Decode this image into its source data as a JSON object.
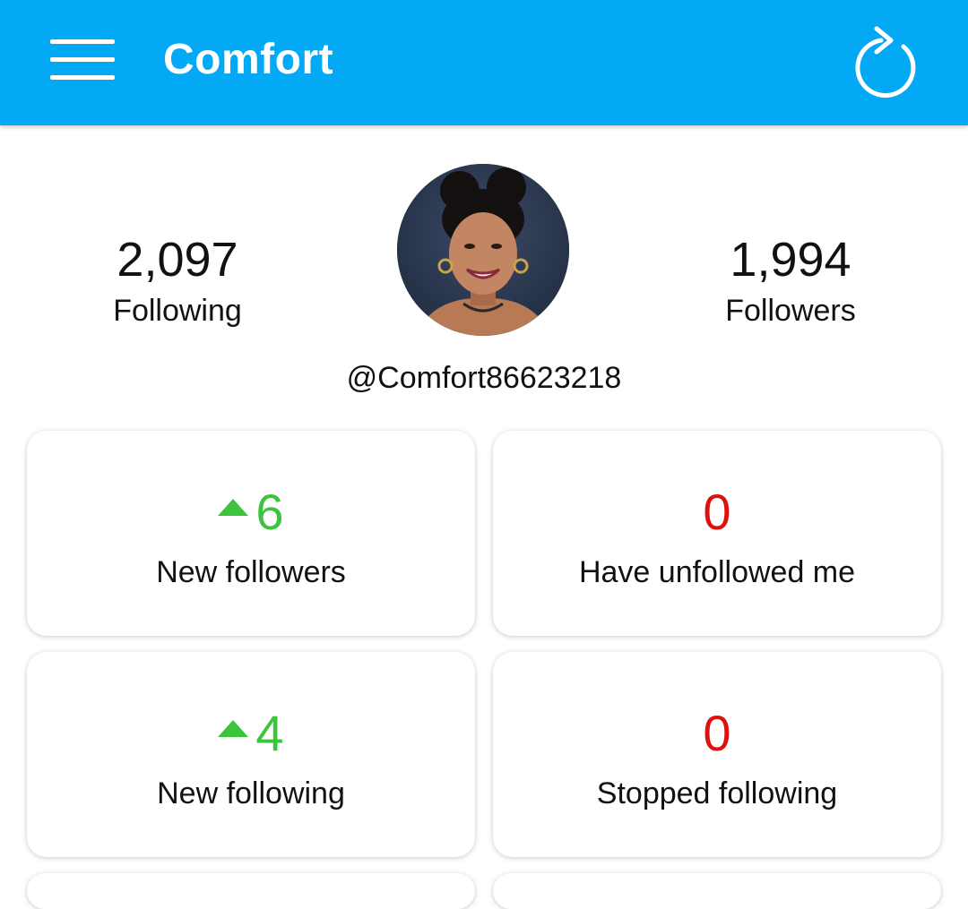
{
  "app_bar": {
    "title": "Comfort",
    "menu_icon": "hamburger-menu-icon",
    "refresh_icon": "refresh-icon",
    "color": "#03a9f4"
  },
  "profile": {
    "following_count": "2,097",
    "following_label": "Following",
    "followers_count": "1,994",
    "followers_label": "Followers",
    "handle": "@Comfort86623218",
    "avatar": "profile-photo"
  },
  "cards": [
    {
      "value": "6",
      "label": "New followers",
      "trend_icon": "up-triangle-icon",
      "color": "#3cc43c"
    },
    {
      "value": "0",
      "label": "Have unfollowed me",
      "color": "#e01010"
    },
    {
      "value": "4",
      "label": "New following",
      "trend_icon": "up-triangle-icon",
      "color": "#3cc43c"
    },
    {
      "value": "0",
      "label": "Stopped following",
      "color": "#e01010"
    }
  ]
}
